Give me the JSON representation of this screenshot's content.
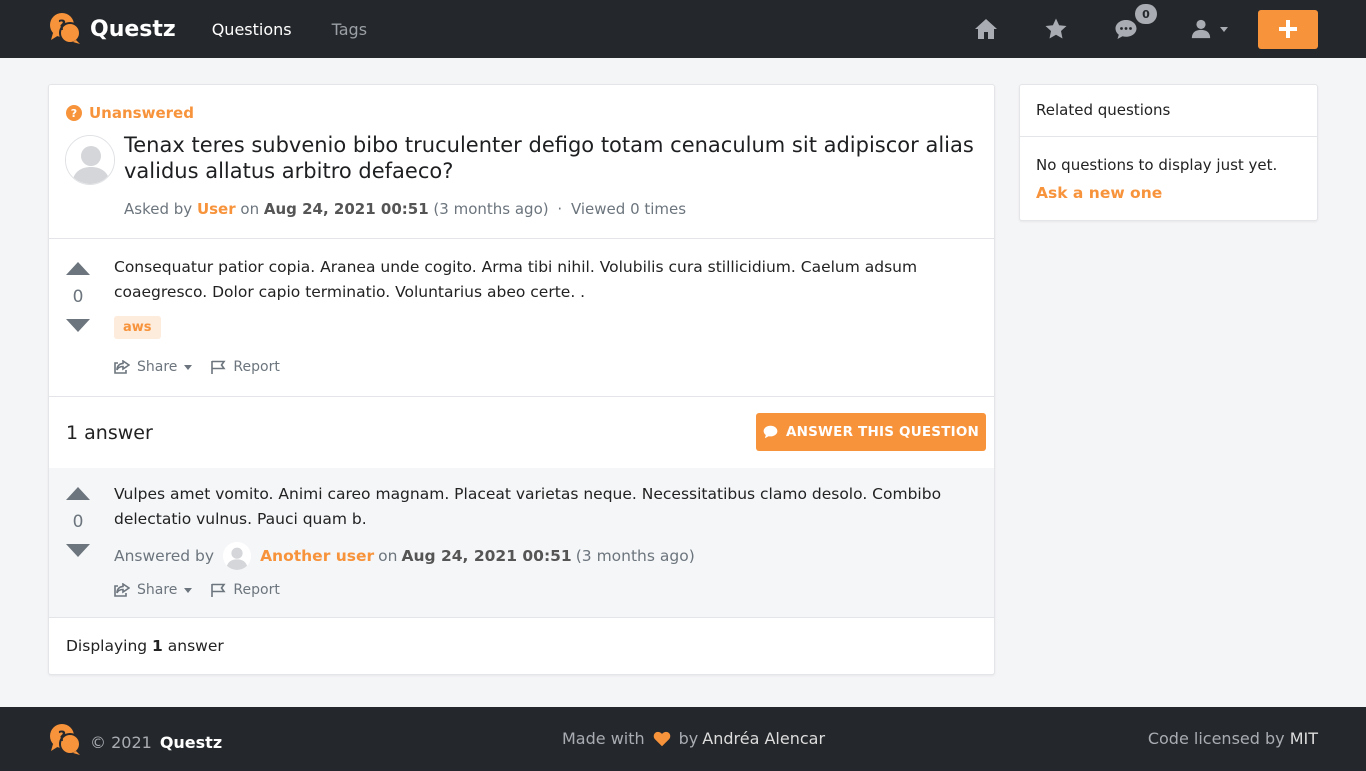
{
  "nav": {
    "brand": "Questz",
    "links": [
      "Questions",
      "Tags"
    ],
    "messages_badge": "0"
  },
  "question": {
    "status": "Unanswered",
    "title": "Tenax teres subvenio bibo truculenter defigo totam cenaculum sit adipiscor alias validus allatus arbitro defaeco?",
    "asked_by_prefix": "Asked by",
    "author": "User",
    "on": "on",
    "date": "Aug 24, 2021 00:51",
    "relative": "(3 months ago)",
    "separator": "·",
    "views": "Viewed 0 times",
    "votes": "0",
    "body": "Consequatur patior copia. Aranea unde cogito. Arma tibi nihil. Volubilis cura stillicidium. Caelum adsum coaegresco. Dolor capio terminatio. Voluntarius abeo certe. .",
    "tag": "aws",
    "share_label": "Share",
    "report_label": "Report"
  },
  "answers": {
    "count_label": "1 answer",
    "answer_button": "ANSWER THIS QUESTION",
    "items": [
      {
        "votes": "0",
        "body": "Vulpes amet vomito. Animi careo magnam. Placeat varietas neque. Necessitatibus clamo desolo. Combibo delectatio vulnus. Pauci quam b.",
        "answered_by": "Answered by",
        "author": "Another user",
        "on": "on",
        "date": "Aug 24, 2021 00:51",
        "relative": "(3 months ago)",
        "share_label": "Share",
        "report_label": "Report"
      }
    ],
    "displaying_prefix": "Displaying",
    "displaying_count": "1",
    "displaying_suffix": "answer"
  },
  "sidebar": {
    "title": "Related questions",
    "empty_text": "No questions to display just yet.",
    "ask_link": "Ask a new one"
  },
  "footer": {
    "copyright": "© 2021",
    "brand": "Questz",
    "made_with": "Made with",
    "by": "by",
    "author": "Andréa Alencar",
    "license_prefix": "Code licensed by",
    "license": "MIT"
  },
  "colors": {
    "accent": "#f7933b",
    "navbar": "#24272b",
    "background": "#f4f5f7"
  }
}
